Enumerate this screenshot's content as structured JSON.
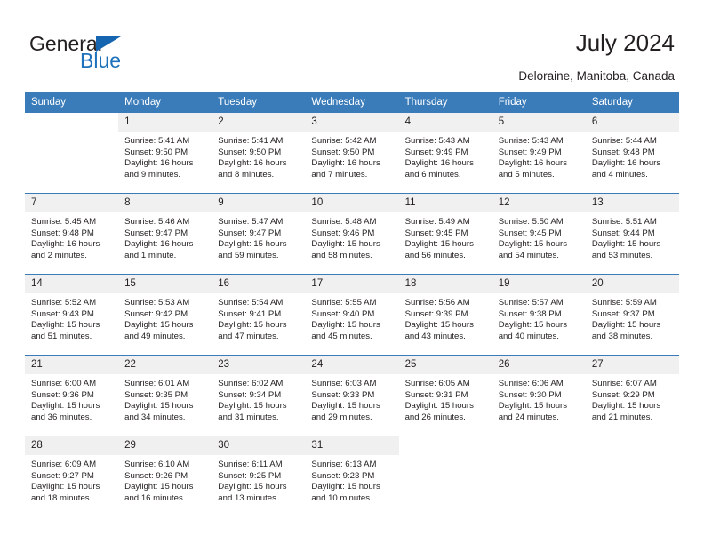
{
  "brand": {
    "name_top": "General",
    "name_bottom": "Blue",
    "accent_color": "#1565b0",
    "text_color": "#231f20"
  },
  "header": {
    "title": "July 2024",
    "location": "Deloraine, Manitoba, Canada"
  },
  "calendar": {
    "header_bg": "#3a7cba",
    "daynum_bg": "#f0f0f0",
    "weekday_headers": [
      "Sunday",
      "Monday",
      "Tuesday",
      "Wednesday",
      "Thursday",
      "Friday",
      "Saturday"
    ],
    "weeks": [
      [
        {
          "day": "",
          "lines": []
        },
        {
          "day": "1",
          "lines": [
            "Sunrise: 5:41 AM",
            "Sunset: 9:50 PM",
            "Daylight: 16 hours",
            "and 9 minutes."
          ]
        },
        {
          "day": "2",
          "lines": [
            "Sunrise: 5:41 AM",
            "Sunset: 9:50 PM",
            "Daylight: 16 hours",
            "and 8 minutes."
          ]
        },
        {
          "day": "3",
          "lines": [
            "Sunrise: 5:42 AM",
            "Sunset: 9:50 PM",
            "Daylight: 16 hours",
            "and 7 minutes."
          ]
        },
        {
          "day": "4",
          "lines": [
            "Sunrise: 5:43 AM",
            "Sunset: 9:49 PM",
            "Daylight: 16 hours",
            "and 6 minutes."
          ]
        },
        {
          "day": "5",
          "lines": [
            "Sunrise: 5:43 AM",
            "Sunset: 9:49 PM",
            "Daylight: 16 hours",
            "and 5 minutes."
          ]
        },
        {
          "day": "6",
          "lines": [
            "Sunrise: 5:44 AM",
            "Sunset: 9:48 PM",
            "Daylight: 16 hours",
            "and 4 minutes."
          ]
        }
      ],
      [
        {
          "day": "7",
          "lines": [
            "Sunrise: 5:45 AM",
            "Sunset: 9:48 PM",
            "Daylight: 16 hours",
            "and 2 minutes."
          ]
        },
        {
          "day": "8",
          "lines": [
            "Sunrise: 5:46 AM",
            "Sunset: 9:47 PM",
            "Daylight: 16 hours",
            "and 1 minute."
          ]
        },
        {
          "day": "9",
          "lines": [
            "Sunrise: 5:47 AM",
            "Sunset: 9:47 PM",
            "Daylight: 15 hours",
            "and 59 minutes."
          ]
        },
        {
          "day": "10",
          "lines": [
            "Sunrise: 5:48 AM",
            "Sunset: 9:46 PM",
            "Daylight: 15 hours",
            "and 58 minutes."
          ]
        },
        {
          "day": "11",
          "lines": [
            "Sunrise: 5:49 AM",
            "Sunset: 9:45 PM",
            "Daylight: 15 hours",
            "and 56 minutes."
          ]
        },
        {
          "day": "12",
          "lines": [
            "Sunrise: 5:50 AM",
            "Sunset: 9:45 PM",
            "Daylight: 15 hours",
            "and 54 minutes."
          ]
        },
        {
          "day": "13",
          "lines": [
            "Sunrise: 5:51 AM",
            "Sunset: 9:44 PM",
            "Daylight: 15 hours",
            "and 53 minutes."
          ]
        }
      ],
      [
        {
          "day": "14",
          "lines": [
            "Sunrise: 5:52 AM",
            "Sunset: 9:43 PM",
            "Daylight: 15 hours",
            "and 51 minutes."
          ]
        },
        {
          "day": "15",
          "lines": [
            "Sunrise: 5:53 AM",
            "Sunset: 9:42 PM",
            "Daylight: 15 hours",
            "and 49 minutes."
          ]
        },
        {
          "day": "16",
          "lines": [
            "Sunrise: 5:54 AM",
            "Sunset: 9:41 PM",
            "Daylight: 15 hours",
            "and 47 minutes."
          ]
        },
        {
          "day": "17",
          "lines": [
            "Sunrise: 5:55 AM",
            "Sunset: 9:40 PM",
            "Daylight: 15 hours",
            "and 45 minutes."
          ]
        },
        {
          "day": "18",
          "lines": [
            "Sunrise: 5:56 AM",
            "Sunset: 9:39 PM",
            "Daylight: 15 hours",
            "and 43 minutes."
          ]
        },
        {
          "day": "19",
          "lines": [
            "Sunrise: 5:57 AM",
            "Sunset: 9:38 PM",
            "Daylight: 15 hours",
            "and 40 minutes."
          ]
        },
        {
          "day": "20",
          "lines": [
            "Sunrise: 5:59 AM",
            "Sunset: 9:37 PM",
            "Daylight: 15 hours",
            "and 38 minutes."
          ]
        }
      ],
      [
        {
          "day": "21",
          "lines": [
            "Sunrise: 6:00 AM",
            "Sunset: 9:36 PM",
            "Daylight: 15 hours",
            "and 36 minutes."
          ]
        },
        {
          "day": "22",
          "lines": [
            "Sunrise: 6:01 AM",
            "Sunset: 9:35 PM",
            "Daylight: 15 hours",
            "and 34 minutes."
          ]
        },
        {
          "day": "23",
          "lines": [
            "Sunrise: 6:02 AM",
            "Sunset: 9:34 PM",
            "Daylight: 15 hours",
            "and 31 minutes."
          ]
        },
        {
          "day": "24",
          "lines": [
            "Sunrise: 6:03 AM",
            "Sunset: 9:33 PM",
            "Daylight: 15 hours",
            "and 29 minutes."
          ]
        },
        {
          "day": "25",
          "lines": [
            "Sunrise: 6:05 AM",
            "Sunset: 9:31 PM",
            "Daylight: 15 hours",
            "and 26 minutes."
          ]
        },
        {
          "day": "26",
          "lines": [
            "Sunrise: 6:06 AM",
            "Sunset: 9:30 PM",
            "Daylight: 15 hours",
            "and 24 minutes."
          ]
        },
        {
          "day": "27",
          "lines": [
            "Sunrise: 6:07 AM",
            "Sunset: 9:29 PM",
            "Daylight: 15 hours",
            "and 21 minutes."
          ]
        }
      ],
      [
        {
          "day": "28",
          "lines": [
            "Sunrise: 6:09 AM",
            "Sunset: 9:27 PM",
            "Daylight: 15 hours",
            "and 18 minutes."
          ]
        },
        {
          "day": "29",
          "lines": [
            "Sunrise: 6:10 AM",
            "Sunset: 9:26 PM",
            "Daylight: 15 hours",
            "and 16 minutes."
          ]
        },
        {
          "day": "30",
          "lines": [
            "Sunrise: 6:11 AM",
            "Sunset: 9:25 PM",
            "Daylight: 15 hours",
            "and 13 minutes."
          ]
        },
        {
          "day": "31",
          "lines": [
            "Sunrise: 6:13 AM",
            "Sunset: 9:23 PM",
            "Daylight: 15 hours",
            "and 10 minutes."
          ]
        },
        {
          "day": "",
          "lines": []
        },
        {
          "day": "",
          "lines": []
        },
        {
          "day": "",
          "lines": []
        }
      ]
    ]
  }
}
